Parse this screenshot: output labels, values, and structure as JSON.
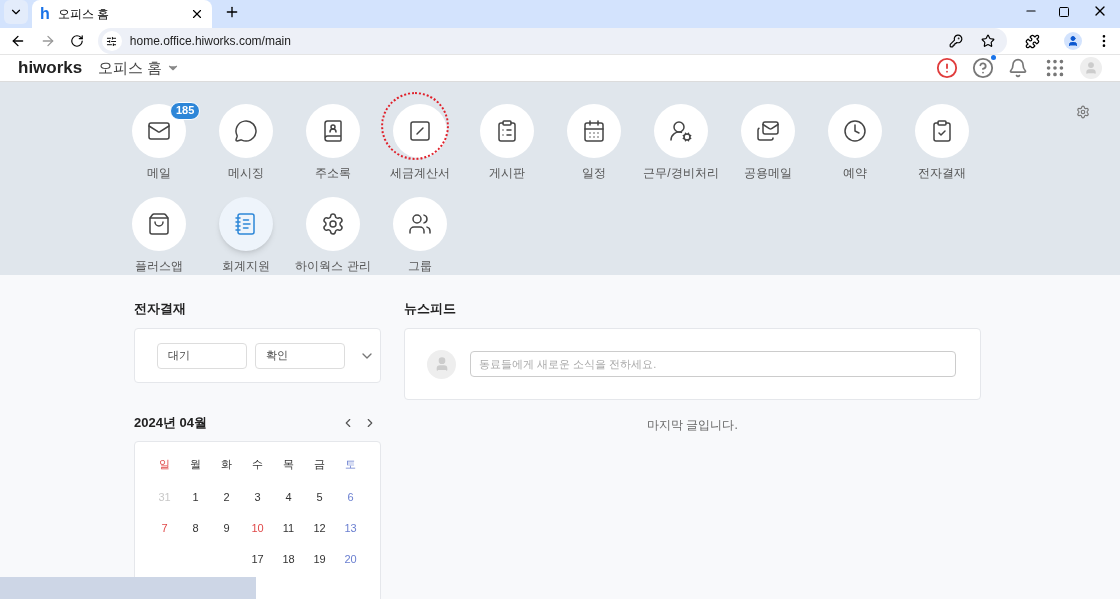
{
  "browser": {
    "favicon": "h",
    "tab_title": "오피스 홈",
    "url": "home.office.hiworks.com/main"
  },
  "header": {
    "logo": "hiworks",
    "title": "오피스 홈",
    "help_has_notice": true
  },
  "apps": [
    {
      "label": "메일",
      "badge": "185",
      "selected": false,
      "annotated": false
    },
    {
      "label": "메시징",
      "selected": false,
      "annotated": false
    },
    {
      "label": "주소록",
      "selected": false,
      "annotated": false
    },
    {
      "label": "세금계산서",
      "selected": false,
      "annotated": true
    },
    {
      "label": "게시판",
      "selected": false,
      "annotated": false
    },
    {
      "label": "일정",
      "selected": false,
      "annotated": false
    },
    {
      "label": "근무/경비처리",
      "selected": false,
      "annotated": false
    },
    {
      "label": "공용메일",
      "selected": false,
      "annotated": false
    },
    {
      "label": "예약",
      "selected": false,
      "annotated": false
    },
    {
      "label": "전자결재",
      "selected": false,
      "annotated": false
    },
    {
      "label": "플러스앱",
      "selected": false,
      "annotated": false
    },
    {
      "label": "회계지원",
      "selected": true,
      "annotated": false
    },
    {
      "label": "하이웍스 관리",
      "selected": false,
      "annotated": false
    },
    {
      "label": "그룹",
      "selected": false,
      "annotated": false
    }
  ],
  "approval": {
    "title": "전자결재",
    "fields": [
      {
        "value": "대기"
      },
      {
        "value": "확인"
      }
    ]
  },
  "calendar": {
    "title": "2024년 04월",
    "weekdays": [
      {
        "text": "일",
        "kind": "sunday"
      },
      {
        "text": "월",
        "kind": "normal"
      },
      {
        "text": "화",
        "kind": "normal"
      },
      {
        "text": "수",
        "kind": "normal"
      },
      {
        "text": "목",
        "kind": "normal"
      },
      {
        "text": "금",
        "kind": "normal"
      },
      {
        "text": "토",
        "kind": "saturday"
      }
    ],
    "weeks": [
      [
        {
          "text": "31",
          "kind": "other_month"
        },
        {
          "text": "1",
          "kind": "normal"
        },
        {
          "text": "2",
          "kind": "normal"
        },
        {
          "text": "3",
          "kind": "normal"
        },
        {
          "text": "4",
          "kind": "normal"
        },
        {
          "text": "5",
          "kind": "normal"
        },
        {
          "text": "6",
          "kind": "saturday"
        }
      ],
      [
        {
          "text": "7",
          "kind": "sunday"
        },
        {
          "text": "8",
          "kind": "normal"
        },
        {
          "text": "9",
          "kind": "normal"
        },
        {
          "text": "10",
          "kind": "holiday"
        },
        {
          "text": "11",
          "kind": "normal"
        },
        {
          "text": "12",
          "kind": "normal"
        },
        {
          "text": "13",
          "kind": "saturday"
        }
      ],
      [
        {
          "text": "17",
          "kind": "normal"
        },
        {
          "text": "18",
          "kind": "normal"
        },
        {
          "text": "19",
          "kind": "normal"
        },
        {
          "text": "20",
          "kind": "saturday"
        }
      ]
    ]
  },
  "newsfeed": {
    "title": "뉴스피드",
    "placeholder": "동료들에게 새로운 소식을 전하세요.",
    "end_message": "마지막 글입니다."
  }
}
